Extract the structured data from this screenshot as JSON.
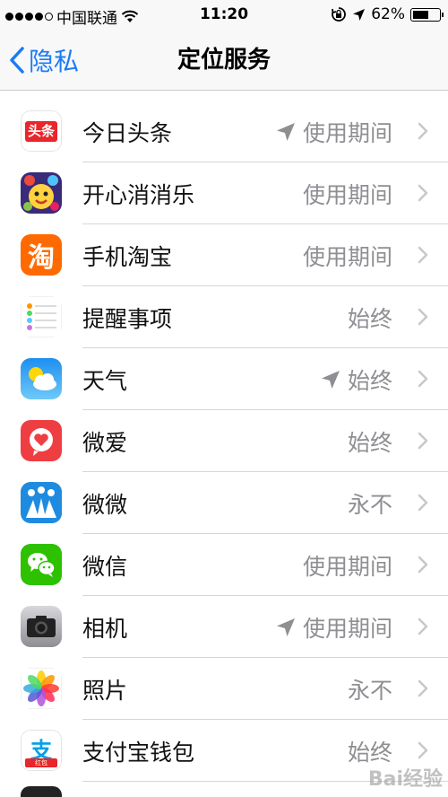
{
  "status_bar": {
    "carrier": "中国联通",
    "time": "11:20",
    "battery_percent_text": "62%",
    "battery_level": 0.62
  },
  "nav": {
    "back_label": "隐私",
    "title": "定位服务"
  },
  "apps": [
    {
      "name": "今日头条",
      "status": "使用期间",
      "recent_location": true,
      "icon": "toutiao-icon",
      "icon_text": "头条"
    },
    {
      "name": "开心消消乐",
      "status": "使用期间",
      "recent_location": false,
      "icon": "xiaoxiaole-icon"
    },
    {
      "name": "手机淘宝",
      "status": "使用期间",
      "recent_location": false,
      "icon": "taobao-icon",
      "icon_text": "淘"
    },
    {
      "name": "提醒事项",
      "status": "始终",
      "recent_location": false,
      "icon": "reminders-icon"
    },
    {
      "name": "天气",
      "status": "始终",
      "recent_location": true,
      "icon": "weather-icon"
    },
    {
      "name": "微爱",
      "status": "始终",
      "recent_location": false,
      "icon": "weiai-icon"
    },
    {
      "name": "微微",
      "status": "永不",
      "recent_location": false,
      "icon": "weiwei-icon"
    },
    {
      "name": "微信",
      "status": "使用期间",
      "recent_location": false,
      "icon": "wechat-icon"
    },
    {
      "name": "相机",
      "status": "使用期间",
      "recent_location": true,
      "icon": "camera-icon"
    },
    {
      "name": "照片",
      "status": "永不",
      "recent_location": false,
      "icon": "photos-icon"
    },
    {
      "name": "支付宝钱包",
      "status": "始终",
      "recent_location": false,
      "icon": "alipay-icon",
      "icon_text": "支",
      "icon_subtext": "红包"
    }
  ],
  "watermark": "Bai经验",
  "colors": {
    "accent": "#1a7cf5",
    "secondary_text": "#8e8e93",
    "separator": "#d6d6d9"
  }
}
